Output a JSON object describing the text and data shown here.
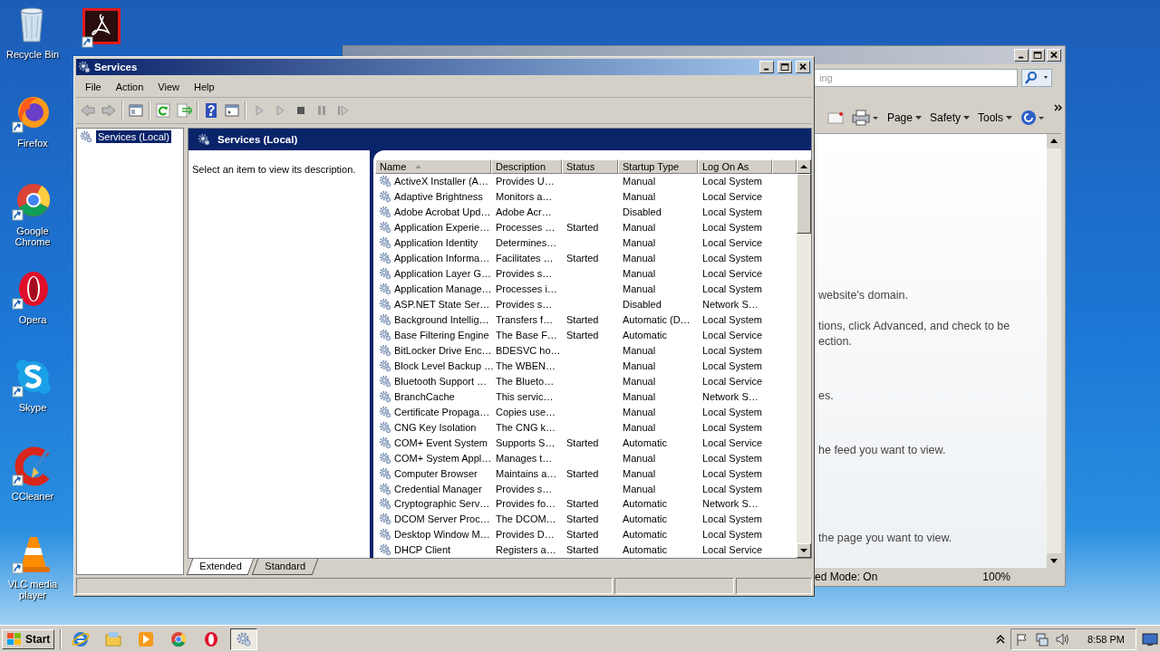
{
  "desktop_icons": [
    {
      "label": "Recycle Bin",
      "kind": "bin"
    },
    {
      "label": "Firefox",
      "kind": "fox"
    },
    {
      "label": "Google Chrome",
      "kind": "chrome"
    },
    {
      "label": "Opera",
      "kind": "opera"
    },
    {
      "label": "Skype",
      "kind": "skype"
    },
    {
      "label": "CCleaner",
      "kind": "cleaner"
    },
    {
      "label": "VLC media player",
      "kind": "cone"
    }
  ],
  "browser_window": {
    "search_placeholder": "ing",
    "commands": [
      "Page",
      "Safety",
      "Tools"
    ],
    "content_lines": [
      "website's domain.",
      "tions, click Advanced, and check to be",
      "ection.",
      "es.",
      "he feed you want to view.",
      "the page you want to view."
    ],
    "status": "ed Mode: On",
    "zoom": "100%"
  },
  "services_window": {
    "title": "Services",
    "menu": [
      "File",
      "Action",
      "View",
      "Help"
    ],
    "tree": [
      {
        "label": "Services (Local)",
        "selected": true
      }
    ],
    "header": "Services (Local)",
    "description_prompt": "Select an item to view its description.",
    "table": {
      "columns": [
        {
          "label": "Name",
          "sorted": true
        },
        {
          "label": "Description",
          "sorted": false
        },
        {
          "label": "Status",
          "sorted": false
        },
        {
          "label": "Startup Type",
          "sorted": false
        },
        {
          "label": "Log On As",
          "sorted": false
        }
      ],
      "rows": [
        [
          "ActiveX Installer (A…",
          "Provides U…",
          "",
          "Manual",
          "Local System"
        ],
        [
          "Adaptive Brightness",
          "Monitors a…",
          "",
          "Manual",
          "Local Service"
        ],
        [
          "Adobe Acrobat Upd…",
          "Adobe Acr…",
          "",
          "Disabled",
          "Local System"
        ],
        [
          "Application Experie…",
          "Processes …",
          "Started",
          "Manual",
          "Local System"
        ],
        [
          "Application Identity",
          "Determines…",
          "",
          "Manual",
          "Local Service"
        ],
        [
          "Application Informa…",
          "Facilitates …",
          "Started",
          "Manual",
          "Local System"
        ],
        [
          "Application Layer G…",
          "Provides s…",
          "",
          "Manual",
          "Local Service"
        ],
        [
          "Application Manage…",
          "Processes i…",
          "",
          "Manual",
          "Local System"
        ],
        [
          "ASP.NET State Ser…",
          "Provides s…",
          "",
          "Disabled",
          "Network S…"
        ],
        [
          "Background Intellig…",
          "Transfers f…",
          "Started",
          "Automatic (D…",
          "Local System"
        ],
        [
          "Base Filtering Engine",
          "The Base F…",
          "Started",
          "Automatic",
          "Local Service"
        ],
        [
          "BitLocker Drive Enc…",
          "BDESVC ho…",
          "",
          "Manual",
          "Local System"
        ],
        [
          "Block Level Backup …",
          "The WBEN…",
          "",
          "Manual",
          "Local System"
        ],
        [
          "Bluetooth Support …",
          "The Blueto…",
          "",
          "Manual",
          "Local Service"
        ],
        [
          "BranchCache",
          "This servic…",
          "",
          "Manual",
          "Network S…"
        ],
        [
          "Certificate Propaga…",
          "Copies use…",
          "",
          "Manual",
          "Local System"
        ],
        [
          "CNG Key Isolation",
          "The CNG k…",
          "",
          "Manual",
          "Local System"
        ],
        [
          "COM+ Event System",
          "Supports S…",
          "Started",
          "Automatic",
          "Local Service"
        ],
        [
          "COM+ System Appl…",
          "Manages t…",
          "",
          "Manual",
          "Local System"
        ],
        [
          "Computer Browser",
          "Maintains a…",
          "Started",
          "Manual",
          "Local System"
        ],
        [
          "Credential Manager",
          "Provides s…",
          "",
          "Manual",
          "Local System"
        ],
        [
          "Cryptographic Serv…",
          "Provides fo…",
          "Started",
          "Automatic",
          "Network S…"
        ],
        [
          "DCOM Server Proc…",
          "The DCOM…",
          "Started",
          "Automatic",
          "Local System"
        ],
        [
          "Desktop Window M…",
          "Provides D…",
          "Started",
          "Automatic",
          "Local System"
        ],
        [
          "DHCP Client",
          "Registers a…",
          "Started",
          "Automatic",
          "Local Service"
        ]
      ]
    },
    "view_tabs": [
      {
        "label": "Extended",
        "selected": true
      },
      {
        "label": "Standard",
        "selected": false
      }
    ]
  },
  "taskbar": {
    "start": "Start",
    "apps": [
      {
        "kind": "ie",
        "selected": false
      },
      {
        "kind": "folder",
        "selected": false
      },
      {
        "kind": "media",
        "selected": false
      },
      {
        "kind": "chrome",
        "selected": false
      },
      {
        "kind": "opera",
        "selected": false
      },
      {
        "kind": "gear",
        "selected": true
      }
    ],
    "clock": "8:58 PM"
  }
}
